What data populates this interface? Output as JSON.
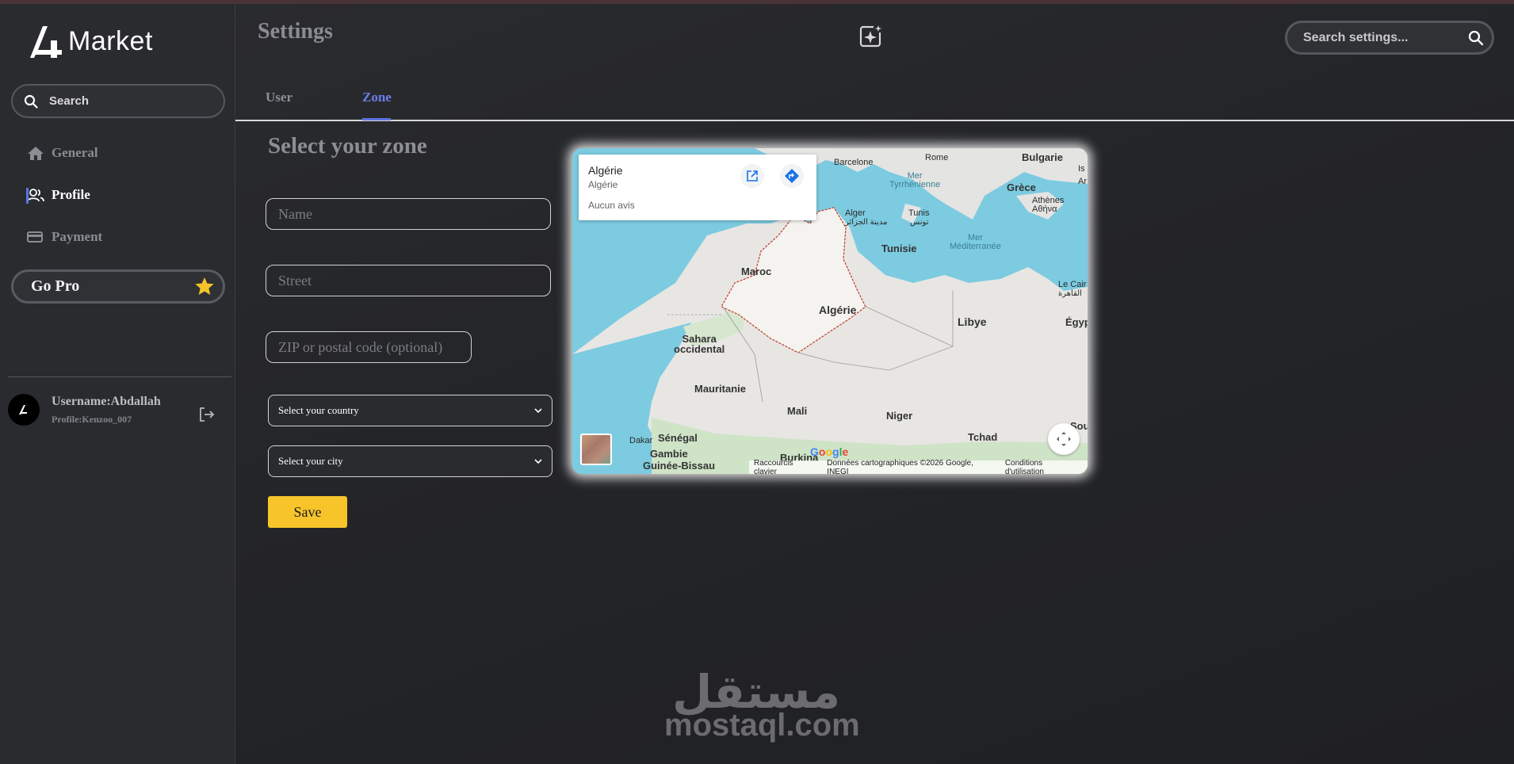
{
  "app": {
    "brand_prefix": "4",
    "brand_name": "Market"
  },
  "sidebar": {
    "search_label": "Search",
    "items": [
      {
        "label": "General",
        "icon": "home-icon"
      },
      {
        "label": "Profile",
        "icon": "users-icon",
        "active": true
      },
      {
        "label": "Payment",
        "icon": "credit-card-icon"
      }
    ],
    "go_pro_label": "Go Pro",
    "user": {
      "username": "Username:Abdallah",
      "profile": "Profile:Kenzoo_007"
    }
  },
  "header": {
    "title": "Settings",
    "search_placeholder": "Search settings..."
  },
  "tabs": [
    {
      "label": "User",
      "active": false
    },
    {
      "label": "Zone",
      "active": true
    }
  ],
  "form": {
    "title": "Select your zone",
    "name_placeholder": "Name",
    "street_placeholder": "Street",
    "zip_placeholder": "ZIP or postal code (optional)",
    "country_select": "Select your country",
    "city_select": "Select your city",
    "save_label": "Save"
  },
  "map": {
    "card": {
      "title": "Algérie",
      "subtitle": "Algérie",
      "reviews": "Aucun avis"
    },
    "labels": {
      "barcelone": "Barcelone",
      "rome": "Rome",
      "bulgarie": "Bulgarie",
      "grece": "Grèce",
      "athenes": "Athènes\nΑθήνα",
      "mer_tyrrhenienne": "Mer\nTyrrhénienne",
      "alger": "Alger",
      "alger_ar": "مدينة الجزائر",
      "tunis": "Tunis",
      "tunis_ar": "تونس",
      "tunisie": "Tunisie",
      "mer_med": "Mer\nMéditerranée",
      "maroc": "Maroc",
      "algerie": "Algérie",
      "libye": "Libye",
      "le_caire": "Le Cair",
      "le_caire_ar": "القاهرة",
      "egypte": "Égyp",
      "sahara": "Sahara\noccidental",
      "mauritanie": "Mauritanie",
      "mali": "Mali",
      "niger": "Niger",
      "tchad": "Tchad",
      "dakar": "Dakar",
      "senegal": "Sénégal",
      "gambie": "Gambie",
      "guinee_bissau": "Guinée-Bissau",
      "burkina": "Burkina",
      "sou": "Sou",
      "is": "Is",
      "ar": "Ar"
    },
    "attribution": {
      "keyboard": "Raccourcis clavier",
      "data": "Données cartographiques ©2026 Google, INEGI",
      "terms": "Conditions d'utilisation"
    },
    "google": "Google"
  },
  "watermark": {
    "arabic": "مستقل",
    "latin": "mostaql.com"
  },
  "colors": {
    "accent": "#5b74e4",
    "save": "#f7c52a",
    "star": "#f7c52a"
  }
}
